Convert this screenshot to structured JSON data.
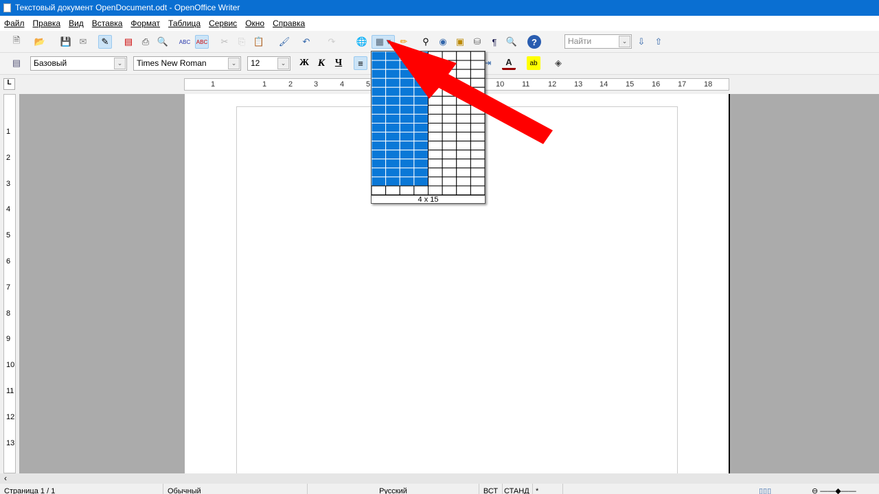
{
  "window": {
    "title": "Текстовый документ OpenDocument.odt - OpenOffice Writer"
  },
  "menu": [
    "Файл",
    "Правка",
    "Вид",
    "Вставка",
    "Формат",
    "Таблица",
    "Сервис",
    "Окно",
    "Справка"
  ],
  "toolbar": {
    "icons": [
      "new-document",
      "open",
      "save",
      "email",
      "edit-mode",
      "export-pdf",
      "print",
      "print-preview",
      "spellcheck",
      "autospellcheck",
      "cut",
      "copy",
      "paste",
      "format-paintbrush",
      "undo",
      "redo",
      "hyperlink",
      "table",
      "draw-functions",
      "find-replace",
      "navigator",
      "gallery",
      "data-sources",
      "nonprinting-characters",
      "zoom",
      "help"
    ],
    "find_placeholder": "Найти"
  },
  "format": {
    "style": "Базовый",
    "font": "Times New Roman",
    "size": "12",
    "bold": "Ж",
    "italic": "К",
    "underline": "Ч"
  },
  "ruler": {
    "h_ticks": [
      "1",
      "1",
      "2",
      "3",
      "4",
      "5",
      "10",
      "11",
      "12",
      "13",
      "14",
      "15",
      "16",
      "17",
      "18"
    ],
    "v_ticks": [
      "1",
      "2",
      "3",
      "4",
      "5",
      "6",
      "7",
      "8",
      "9",
      "10",
      "11",
      "12",
      "13"
    ]
  },
  "table_popup": {
    "columns": 8,
    "rows": 16,
    "selected_cols": 4,
    "selected_rows": 15,
    "label": "4 x 15",
    "highlight_color": "#0a78d7"
  },
  "status": {
    "page": "Страница 1 / 1",
    "style": "Обычный",
    "language": "Русский",
    "insert": "ВСТ",
    "selection": "СТАНД",
    "modified": "*"
  },
  "annotation": {
    "arrow_color": "#ff0000"
  }
}
